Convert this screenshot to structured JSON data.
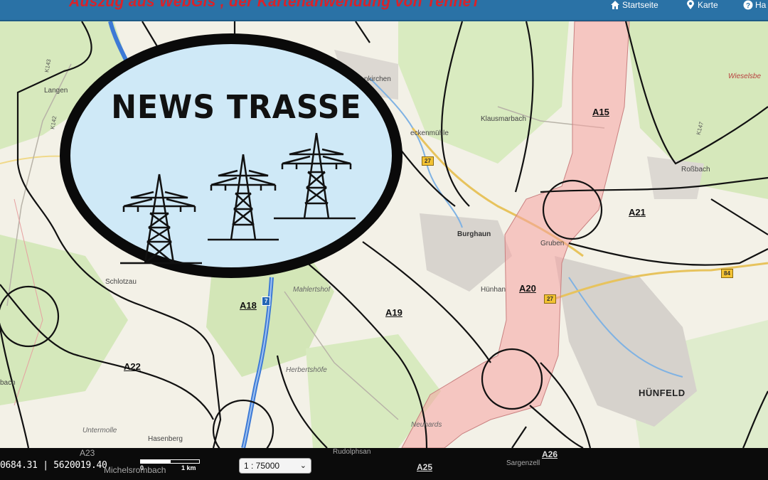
{
  "header": {
    "title": "Auszug aus WebGis , der Kartenanwendung von TenneT",
    "nav": [
      {
        "label": "Startseite",
        "icon": "home-icon"
      },
      {
        "label": "Karte",
        "icon": "map-marker-icon"
      },
      {
        "label": "Ha",
        "icon": "help-icon"
      }
    ]
  },
  "overlay": {
    "title": "NEWS TRASSE",
    "icon": "power-pylon-icon"
  },
  "map": {
    "places": {
      "langen": "Langen",
      "ghkirchen": "nkirchen",
      "klausmarbach": "Klausmarbach",
      "wieselsbe": "Wieselsbe",
      "eckenmuehle": "eckenmühle",
      "rossbach": "Roßbach",
      "burghaun": "Burghaun",
      "gruben": "Gruben",
      "schlotzau": "Schlotzau",
      "mahlertshof": "Mahlertshof",
      "huenhan": "Hünhan",
      "huenfeld": "HÜNFELD",
      "herbertshoefe": "Herbertshöfe",
      "bach": "bach",
      "untermolle": "Untermolle",
      "hasenberg": "Hasenberg",
      "neuhards": "Neuhards",
      "rudolphsan": "Rudolphsan",
      "michelsrombach": "Michelsrombach",
      "sargenzell": "Sargenzell"
    },
    "segments": [
      "A15",
      "A21",
      "A20",
      "A19",
      "A18",
      "A22",
      "A23",
      "A25",
      "A26"
    ],
    "roads": {
      "k143": "K143",
      "k142": "K142",
      "k147": "K147",
      "b27a": "27",
      "b27b": "27",
      "b84": "84",
      "a7": "7"
    },
    "colors": {
      "corridor": "#f5a3a3",
      "corridor_stroke": "#c98080",
      "line": "#111111",
      "autobahn": "#3d7ad6",
      "water": "#7fb2e3"
    }
  },
  "statusbar": {
    "coords": "0684.31 | 5620019.40",
    "scale_label_0": "0",
    "scale_label_1": "1 km",
    "scale_value": "1 : 75000"
  }
}
